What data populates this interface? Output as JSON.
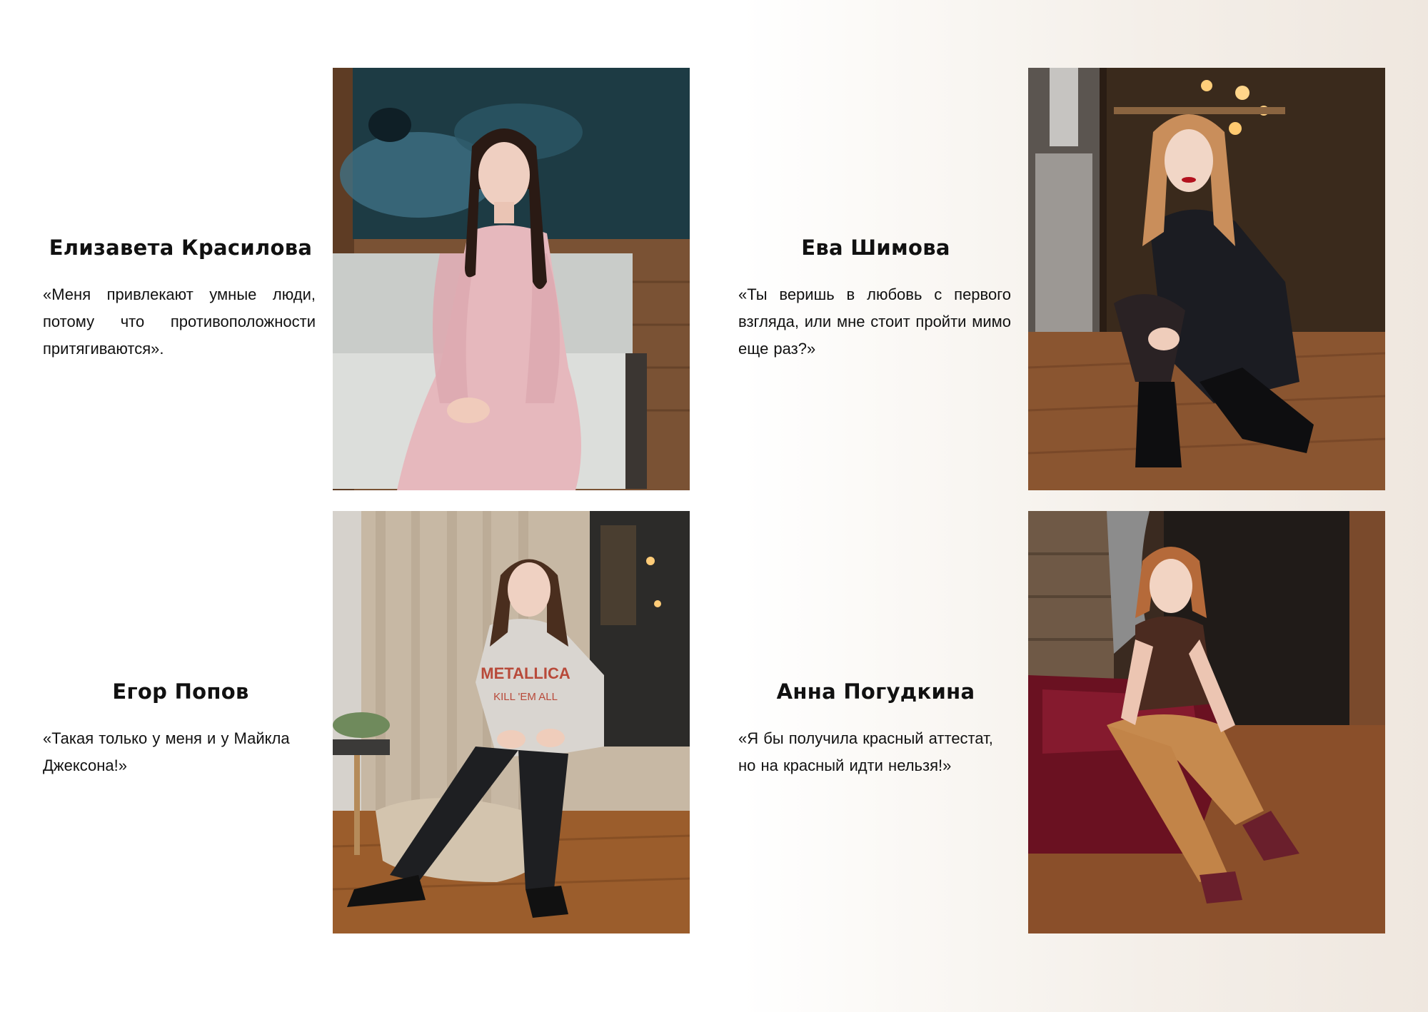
{
  "profiles": [
    {
      "name": "Елизавета Красилова",
      "quote": "«Меня привлекают умные люди, потому что противоположности притягиваются».",
      "photo_icon": "portrait-photo"
    },
    {
      "name": "Ева Шимова",
      "quote": "«Ты веришь в любовь с первого взгляда, или мне стоит пройти мимо еще раз?»",
      "photo_icon": "portrait-photo"
    },
    {
      "name": "Егор Попов",
      "quote": "«Такая только у меня и у Майкла Джексона!»",
      "photo_icon": "portrait-photo"
    },
    {
      "name": "Анна Погудкина",
      "quote": "«Я бы получила красный аттестат, но на красный идти нельзя!»",
      "photo_icon": "portrait-photo"
    }
  ],
  "photo_texts": {
    "hoodie_logo": "METALLICA",
    "hoodie_slogan": "KILL 'EM ALL"
  },
  "colors": {
    "text": "#111111",
    "background_right": "#efe7df"
  }
}
